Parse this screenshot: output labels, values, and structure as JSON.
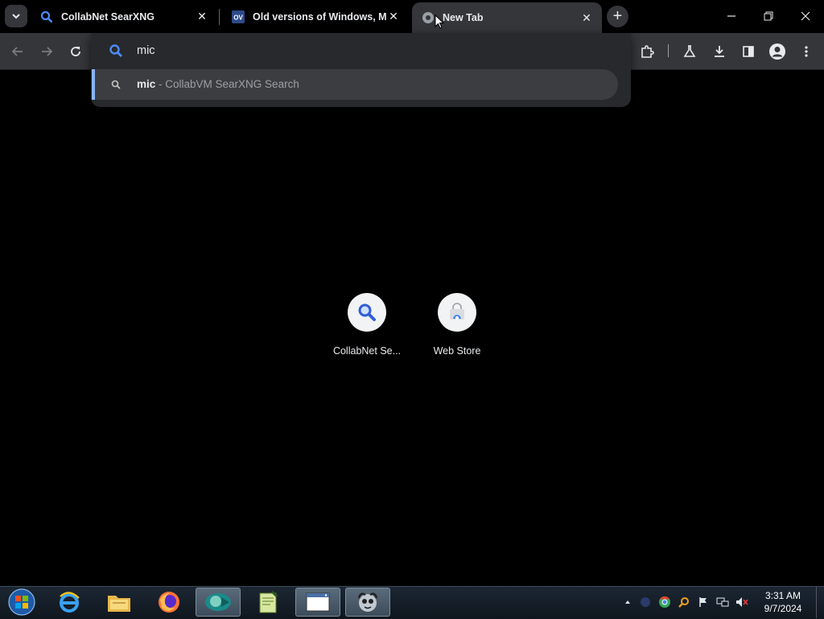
{
  "tabs": [
    {
      "title": "CollabNet SearXNG",
      "favicon": "search-icon"
    },
    {
      "title": "Old versions of Windows, Mac",
      "favicon": "ov-logo-icon"
    },
    {
      "title": "New Tab",
      "favicon": "chrome-globe-icon",
      "active": true
    }
  ],
  "omnibox": {
    "value": "mic",
    "suggestion_query": "mic",
    "suggestion_rest": " - CollabVM SearXNG Search"
  },
  "shortcuts": [
    {
      "label": "CollabNet Se...",
      "icon": "search-icon"
    },
    {
      "label": "Web Store",
      "icon": "webstore-icon"
    }
  ],
  "taskbar": {
    "apps": [
      "internet-explorer-icon",
      "file-explorer-icon",
      "firefox-icon",
      "chrome-app-icon",
      "notepad-plus-icon",
      "window-app-icon",
      "napster-icon"
    ],
    "clock_time": "3:31 AM",
    "clock_date": "9/7/2024"
  },
  "colors": {
    "accent": "#8ab4f8",
    "toolbar": "#35363a",
    "background": "#000000",
    "search_icon_blue": "#4c8bf5"
  }
}
